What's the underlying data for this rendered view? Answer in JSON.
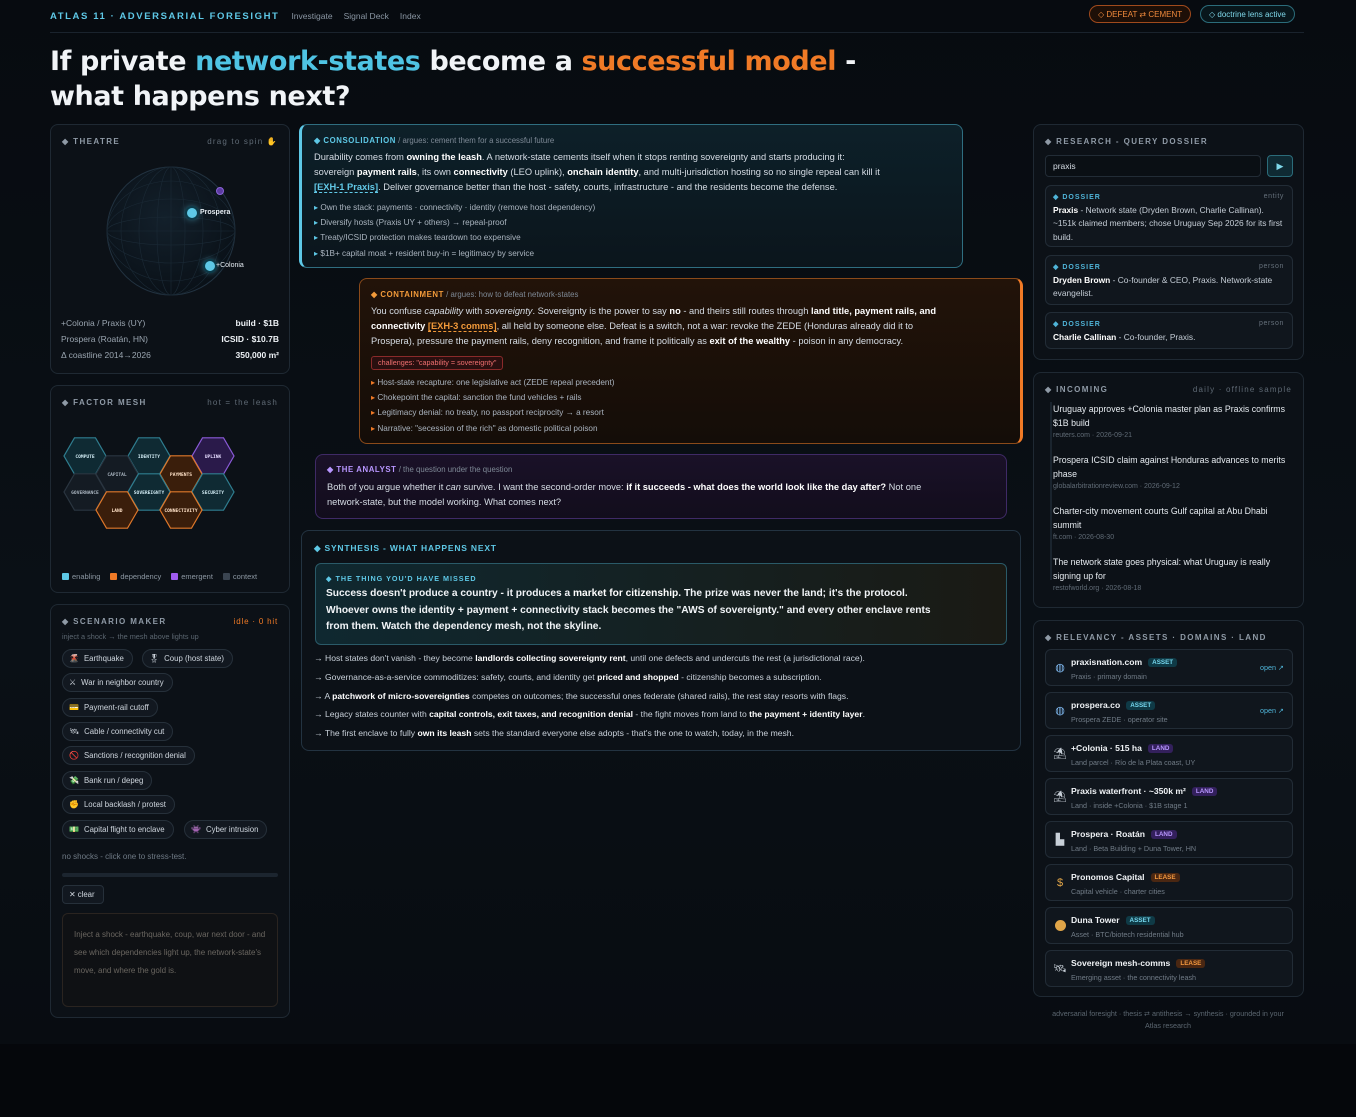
{
  "nav": {
    "brand": "ATLAS 11 · ADVERSARIAL FORESIGHT",
    "links": [
      "Investigate",
      "Signal Deck",
      "Index"
    ],
    "pill_defeat": "◇ DEFEAT ⇄ CEMENT",
    "pill_lens": "◇ doctrine lens active"
  },
  "headline": {
    "p1": "If private ",
    "p2": "network-states",
    "p3": " become a ",
    "p4": "successful model",
    "p5": " -",
    "p6": "what happens next?"
  },
  "theatre": {
    "title": "◆ THEATRE",
    "hint": "drag to spin ✋",
    "markers": [
      "Prospera",
      "+Colonia"
    ],
    "stats": [
      {
        "label": "+Colonia / Praxis (UY)",
        "value": "build · $1B"
      },
      {
        "label": "Prospera (Roatán, HN)",
        "value": "ICSID · $10.7B"
      },
      {
        "label": "Δ coastline 2014→2026",
        "value": "350,000 m²"
      }
    ]
  },
  "mesh": {
    "title": "◆ FACTOR MESH",
    "hint": "hot = the leash",
    "nodes": [
      "COMPUTE",
      "IDENTITY",
      "UPLINK",
      "CAPITAL",
      "PAYMENTS",
      "GOVERNANCE",
      "SOVEREIGNTY",
      "SECURITY",
      "LAND",
      "CONNECTIVITY"
    ],
    "legend": [
      "enabling",
      "dependency",
      "emergent",
      "context"
    ],
    "colors": {
      "enabling": "#5ec8e6",
      "dependency": "#f07a26",
      "emergent": "#a05cf0",
      "context": "#3a4450"
    }
  },
  "scenario": {
    "title": "◆ SCENARIO MAKER",
    "status": "idle · 0 hit",
    "sub": "inject a shock → the mesh above lights up",
    "chips": [
      {
        "icon": "🌋",
        "label": "Earthquake"
      },
      {
        "icon": "🎖",
        "label": "Coup (host state)"
      },
      {
        "icon": "⚔",
        "label": "War in neighbor country"
      },
      {
        "icon": "💳",
        "label": "Payment-rail cutoff"
      },
      {
        "icon": "🛰",
        "label": "Cable / connectivity cut"
      },
      {
        "icon": "🚫",
        "label": "Sanctions / recognition denial"
      },
      {
        "icon": "💸",
        "label": "Bank run / depeg"
      },
      {
        "icon": "✊",
        "label": "Local backlash / protest"
      },
      {
        "icon": "💵",
        "label": "Capital flight to enclave"
      },
      {
        "icon": "👾",
        "label": "Cyber intrusion"
      }
    ],
    "empty": "no shocks - click one to stress-test.",
    "clear": "✕ clear",
    "placeholder": "Inject a shock - earthquake, coup, war next door - and see which dependencies light up, the network-state's move, and where the gold is."
  },
  "consolidation": {
    "title": "◆ CONSOLIDATION",
    "sub": " / argues: cement them for a successful future",
    "b1": "Durability comes from ",
    "b2": "owning the leash",
    "b3": ". A network-state cements itself when it stops renting sovereignty and starts producing it:",
    "b4": "sovereign ",
    "b5": "payment rails",
    "b6": ", its own ",
    "b7": "connectivity",
    "b8": " (LEO uplink), ",
    "b9": "onchain identity",
    "b10": ", and multi-jurisdiction hosting so no single repeal can kill it",
    "b11": "[EXH-1 Praxis]",
    "b12": ". Deliver governance better than the host - safety, courts, infrastructure - and the residents become the defense.",
    "bullets": [
      "Own the stack: payments · connectivity · identity (remove host dependency)",
      "Diversify hosts (Praxis UY + others) → repeal-proof",
      "Treaty/ICSID protection makes teardown too expensive",
      "$1B+ capital moat + resident buy-in = legitimacy by service"
    ]
  },
  "containment": {
    "title": "◆ CONTAINMENT",
    "sub": " / argues: how to defeat network-states",
    "b1": "You confuse ",
    "b2": "capability",
    "b3": " with ",
    "b4": "sovereignty",
    "b5": ". Sovereignty is the power to say ",
    "b6": "no",
    "b7": " - and theirs still routes through ",
    "b8": "land title, payment rails, and",
    "b9": "connectivity",
    "b10": " ",
    "b11": "[EXH-3 comms]",
    "b12": ", all held by someone else. Defeat is a switch, not a war: revoke the ZEDE (Honduras already did it to",
    "b13": "Prospera), pressure the payment rails, deny recognition, and frame it politically as ",
    "b14": "exit of the wealthy",
    "b15": " - poison in any democracy.",
    "challenge": "challenges: \"capability = sovereignty\"",
    "bullets": [
      "Host-state recapture: one legislative act (ZEDE repeal precedent)",
      "Chokepoint the capital: sanction the fund vehicles + rails",
      "Legitimacy denial: no treaty, no passport reciprocity → a resort",
      "Narrative: \"secession of the rich\" as domestic political poison"
    ]
  },
  "analyst": {
    "title": "◆ THE ANALYST",
    "sub": " / the question under the question",
    "b1": "Both of you argue whether it ",
    "b2": "can",
    "b3": " survive. I want the second-order move: ",
    "b4": "if it succeeds - what does the world look like the day after?",
    "b5": " Not one",
    "b6": "network-state, but the model working. What comes next?"
  },
  "synthesis": {
    "title": "◆ SYNTHESIS - WHAT HAPPENS NEXT",
    "missed_title": "◆ THE THING YOU'D HAVE MISSED",
    "m1": "Success doesn't produce a country - it produces a ",
    "m2": "market for citizenship",
    "m3": ". The prize was never the land; it's the ",
    "m4": "protocol",
    "m5": ".",
    "m6": "Whoever owns the identity + payment + connectivity stack becomes the ",
    "m7": "\"AWS of sovereignty.\"",
    "m8": " and every other enclave rents",
    "m9": "from them. Watch the dependency mesh, not the skyline.",
    "items": [
      [
        "→ Host states don't vanish - they become ",
        "landlords collecting sovereignty rent",
        ", until one defects and undercuts the rest (a jurisdictional race)."
      ],
      [
        "→ Governance-as-a-service commoditizes: safety, courts, and identity get ",
        "priced and shopped",
        " - citizenship becomes a subscription."
      ],
      [
        "→ A ",
        "patchwork of micro-sovereignties",
        " competes on outcomes; the successful ones federate (shared rails), the rest stay resorts with flags."
      ],
      [
        "→ Legacy states counter with ",
        "capital controls, exit taxes, and recognition denial",
        " - the fight moves from land to ",
        "the payment + identity layer",
        "."
      ],
      [
        "→ The first enclave to fully ",
        "own its leash",
        " sets the standard everyone else adopts - that's the one to watch, today, in the mesh."
      ]
    ]
  },
  "research": {
    "title": "◆ RESEARCH - QUERY DOSSIER",
    "query": "praxis",
    "go": "▶",
    "dossiers": [
      {
        "label": "◆ DOSSIER",
        "type": "entity",
        "name": "Praxis",
        "text": " - Network state (Dryden Brown, Charlie Callinan). ~151k claimed members; chose Uruguay Sep 2026 for its first build."
      },
      {
        "label": "◆ DOSSIER",
        "type": "person",
        "name": "Dryden Brown",
        "text": " - Co-founder & CEO, Praxis. Network-state evangelist."
      },
      {
        "label": "◆ DOSSIER",
        "type": "person",
        "name": "Charlie Callinan",
        "text": " - Co-founder, Praxis."
      }
    ]
  },
  "incoming": {
    "title": "◆ INCOMING",
    "hint": "daily · offline sample",
    "items": [
      {
        "title": "Uruguay approves +Colonia master plan as Praxis confirms $1B build",
        "meta": "reuters.com · 2026-09-21"
      },
      {
        "title": "Prospera ICSID claim against Honduras advances to merits phase",
        "meta": "globalarbitrationreview.com · 2026-09-12"
      },
      {
        "title": "Charter-city movement courts Gulf capital at Abu Dhabi summit",
        "meta": "ft.com · 2026-08-30"
      },
      {
        "title": "The network state goes physical: what Uruguay is really signing up for",
        "meta": "restofworld.org · 2026-08-18"
      }
    ]
  },
  "relevancy": {
    "title": "◆ RELEVANCY - ASSETS · DOMAINS · LAND",
    "items": [
      {
        "icon": "globe-icon",
        "name": "praxisnation.com",
        "tag": "ASSET",
        "desc": "Praxis · primary domain",
        "open": "open ↗"
      },
      {
        "icon": "globe-icon",
        "name": "prospera.co",
        "tag": "ASSET",
        "desc": "Prospera ZEDE · operator site",
        "open": "open ↗"
      },
      {
        "icon": "land-icon",
        "name": "+Colonia · 515 ha",
        "tag": "LAND",
        "desc": "Land parcel · Río de la Plata coast, UY"
      },
      {
        "icon": "land-icon",
        "name": "Praxis waterfront · ~350k m²",
        "tag": "LAND",
        "desc": "Land · inside +Colonia · $1B stage 1"
      },
      {
        "icon": "building-icon",
        "name": "Prospera · Roatán",
        "tag": "LAND",
        "desc": "Land · Beta Building + Duna Tower, HN"
      },
      {
        "icon": "money-bag-icon",
        "name": "Pronomos Capital",
        "tag": "LEASE",
        "desc": "Capital vehicle · charter cities"
      },
      {
        "icon": "coin-icon",
        "name": "Duna Tower",
        "tag": "ASSET",
        "desc": "Asset · BTC/biotech residential hub"
      },
      {
        "icon": "satellite-icon",
        "name": "Sovereign mesh-comms",
        "tag": "LEASE",
        "desc": "Emerging asset · the connectivity leash"
      }
    ]
  },
  "footer": {
    "l1": "adversarial foresight · thesis ⇄ antithesis → synthesis · grounded in your",
    "l2": "Atlas research"
  }
}
